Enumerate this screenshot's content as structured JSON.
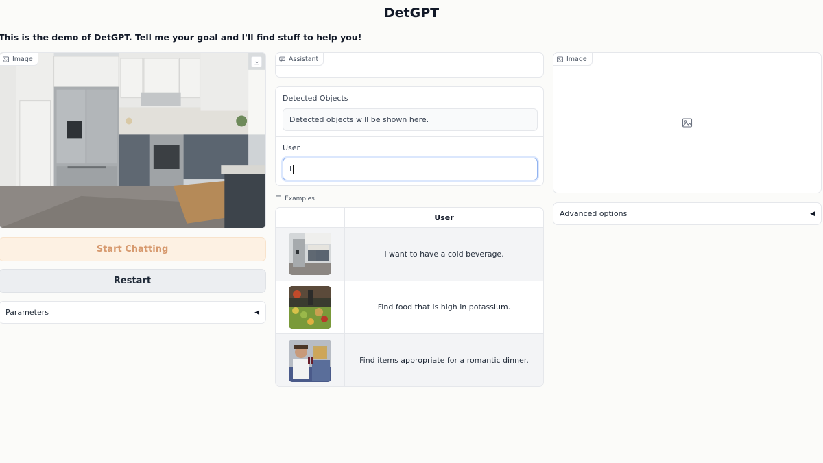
{
  "app": {
    "title": "DetGPT",
    "description": "This is the demo of DetGPT. Tell me your goal and I'll find stuff to help you!"
  },
  "left": {
    "image_label": "Image",
    "start_button": "Start Chatting",
    "restart_button": "Restart",
    "parameters_label": "Parameters"
  },
  "middle": {
    "assistant_label": "Assistant",
    "detected_label": "Detected Objects",
    "detected_placeholder": "Detected objects will be shown here.",
    "user_label": "User",
    "user_value": "I",
    "examples_label": "Examples",
    "examples_header": "User",
    "examples": [
      {
        "text": "I want to have a cold beverage.",
        "thumb": "kitchen"
      },
      {
        "text": "Find food that is high in potassium.",
        "thumb": "market"
      },
      {
        "text": "Find items appropriate for a romantic dinner.",
        "thumb": "couple"
      }
    ]
  },
  "right": {
    "image_label": "Image",
    "advanced_label": "Advanced options"
  },
  "icons": {
    "image": "image-icon",
    "download": "download-icon",
    "chat": "chat-icon",
    "list": "list-icon",
    "collapse": "triangle-left-icon"
  },
  "colors": {
    "start_bg": "#fdf1e3",
    "start_text": "#d79a6f",
    "restart_bg": "#eceef1",
    "focus_border": "#93b4f0"
  }
}
